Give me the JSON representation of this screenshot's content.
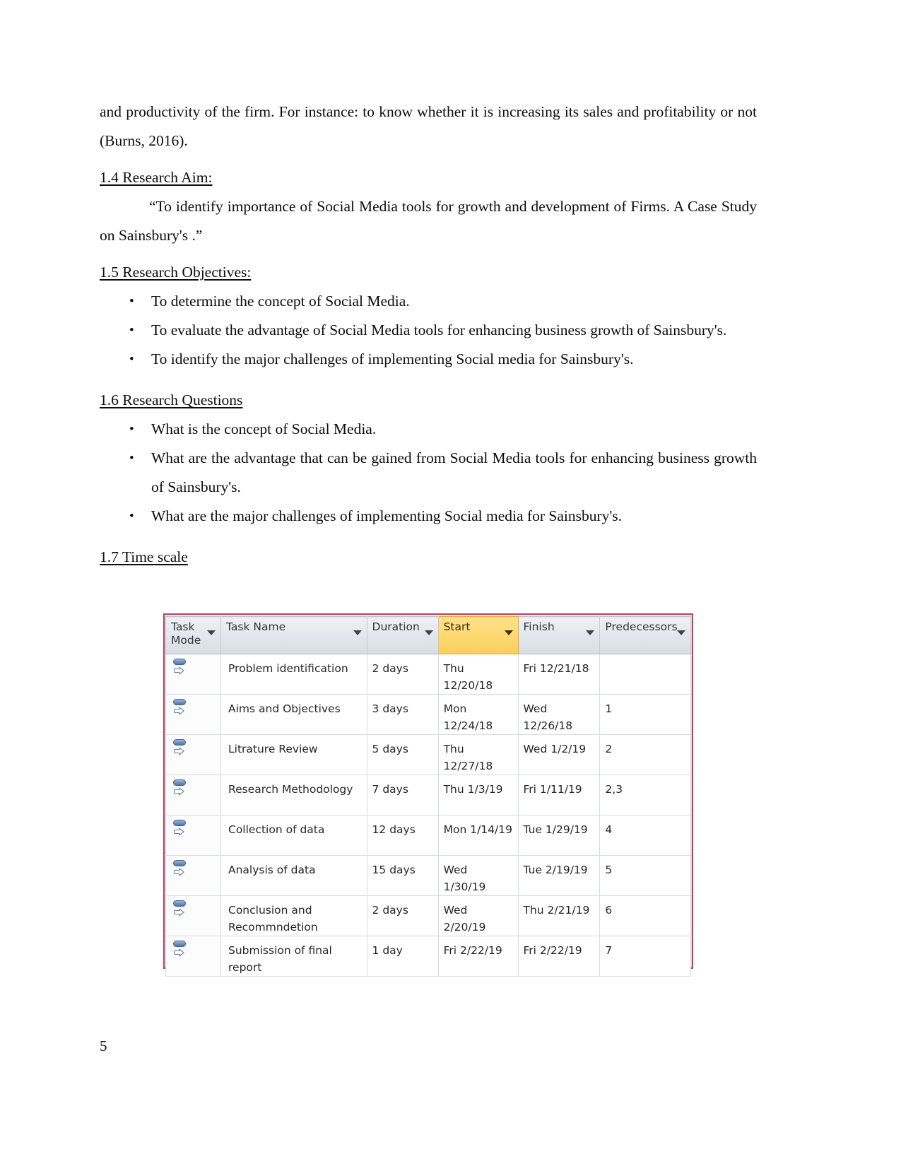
{
  "document": {
    "page_number": "5",
    "opening_paragraph": "and productivity of the firm. For instance: to know whether it is increasing its sales and profitability or not (Burns, 2016).",
    "sections": {
      "research_aim": {
        "heading": "1.4 Research Aim:",
        "body": "“To identify importance of Social Media tools for growth and development of Firms. A Case Study on Sainsbury's .”"
      },
      "research_objectives": {
        "heading": "1.5 Research Objectives:",
        "items": [
          "To determine the concept of Social Media.",
          "To evaluate the advantage of Social Media tools for enhancing business growth of Sainsbury's.",
          "To identify the major challenges of implementing Social media for Sainsbury's."
        ]
      },
      "research_questions": {
        "heading": "1.6 Research Questions",
        "items": [
          "What is the concept of Social Media.",
          "What are the advantage that can be gained from Social Media tools for enhancing business growth of Sainsbury's.",
          "What are the major challenges of implementing Social media for Sainsbury's."
        ]
      },
      "time_scale": {
        "heading": "1.7 Time scale"
      }
    }
  },
  "project_table": {
    "border_color": "#c0415a",
    "highlight_color": "#fdd86f",
    "header_background": "#e2e6ec",
    "task_mode_icon": "auto-scheduled-icon",
    "columns": [
      {
        "label": "Task\nMode",
        "filter": true,
        "highlighted": false
      },
      {
        "label": "Task Name",
        "filter": true,
        "highlighted": false
      },
      {
        "label": "Duration",
        "filter": true,
        "highlighted": false
      },
      {
        "label": "Start",
        "filter": true,
        "highlighted": true
      },
      {
        "label": "Finish",
        "filter": true,
        "highlighted": false
      },
      {
        "label": "Predecessors",
        "filter": true,
        "highlighted": false
      }
    ],
    "rows": [
      {
        "task_name": "Problem identification",
        "duration": "2 days",
        "start": "Thu 12/20/18",
        "finish": "Fri 12/21/18",
        "predecessors": ""
      },
      {
        "task_name": "Aims and Objectives",
        "duration": "3 days",
        "start": "Mon 12/24/18",
        "finish": "Wed 12/26/18",
        "predecessors": "1"
      },
      {
        "task_name": "Litrature Review",
        "duration": "5 days",
        "start": "Thu 12/27/18",
        "finish": "Wed 1/2/19",
        "predecessors": "2"
      },
      {
        "task_name": "Research Methodology",
        "duration": "7 days",
        "start": "Thu 1/3/19",
        "finish": "Fri 1/11/19",
        "predecessors": "2,3"
      },
      {
        "task_name": "Collection of data",
        "duration": "12 days",
        "start": "Mon 1/14/19",
        "finish": "Tue 1/29/19",
        "predecessors": "4"
      },
      {
        "task_name": "Analysis of data",
        "duration": "15 days",
        "start": "Wed 1/30/19",
        "finish": "Tue 2/19/19",
        "predecessors": "5"
      },
      {
        "task_name": "Conclusion and Recommndetion",
        "duration": "2 days",
        "start": "Wed 2/20/19",
        "finish": "Thu 2/21/19",
        "predecessors": "6"
      },
      {
        "task_name": "Submission of final report",
        "duration": "1 day",
        "start": "Fri 2/22/19",
        "finish": "Fri 2/22/19",
        "predecessors": "7"
      }
    ]
  }
}
